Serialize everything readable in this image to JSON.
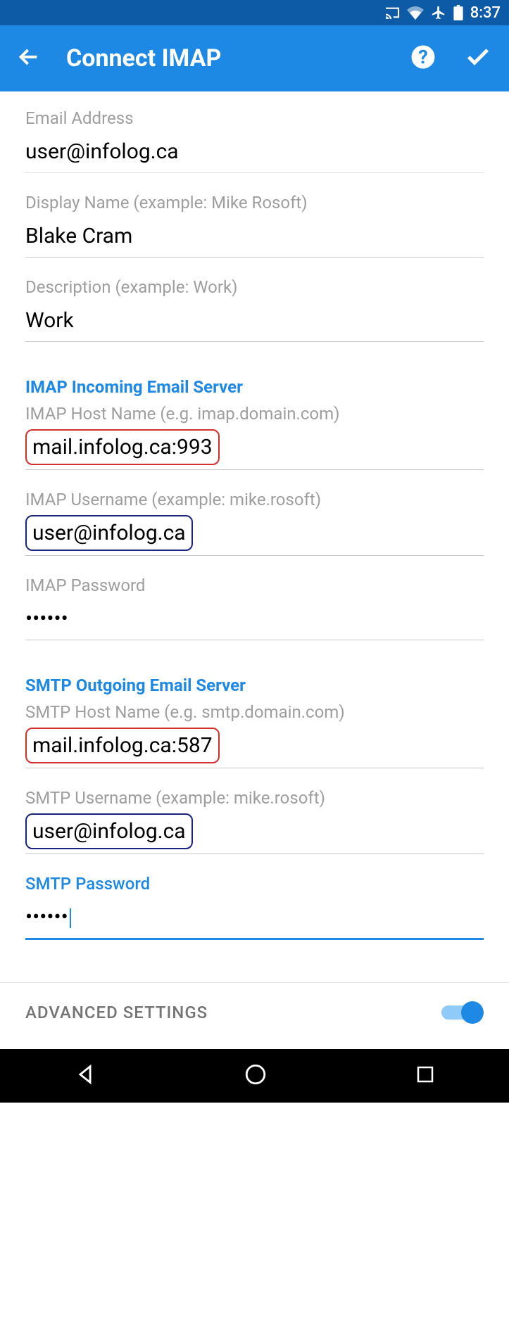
{
  "status": {
    "time": "8:37"
  },
  "appbar": {
    "title": "Connect IMAP"
  },
  "fields": {
    "email": {
      "label": "Email Address",
      "value": "user@infolog.ca"
    },
    "display": {
      "label": "Display Name (example: Mike Rosoft)",
      "value": "Blake Cram"
    },
    "desc": {
      "label": "Description (example: Work)",
      "value": "Work"
    }
  },
  "imap": {
    "header": "IMAP Incoming Email Server",
    "host": {
      "label": "IMAP Host Name (e.g. imap.domain.com)",
      "value": "mail.infolog.ca:993"
    },
    "user": {
      "label": "IMAP Username (example: mike.rosoft)",
      "value": "user@infolog.ca"
    },
    "pass": {
      "label": "IMAP Password",
      "value": "••••••"
    }
  },
  "smtp": {
    "header": "SMTP Outgoing Email Server",
    "host": {
      "label": "SMTP Host Name (e.g. smtp.domain.com)",
      "value": "mail.infolog.ca:587"
    },
    "user": {
      "label": "SMTP Username (example: mike.rosoft)",
      "value": "user@infolog.ca"
    },
    "pass": {
      "label": "SMTP Password",
      "value": "••••••"
    }
  },
  "advanced": {
    "label": "ADVANCED SETTINGS",
    "on": true
  }
}
